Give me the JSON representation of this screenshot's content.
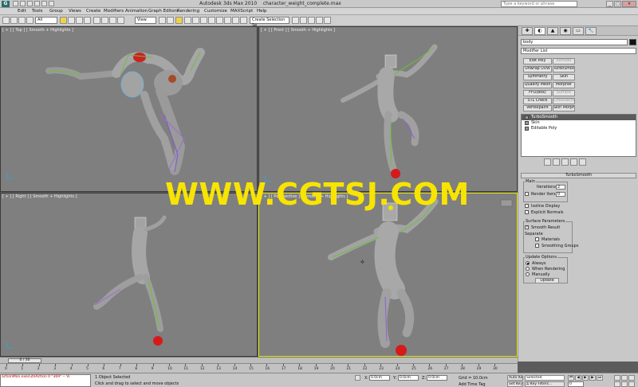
{
  "window": {
    "logo": "G",
    "title": "Autodesk 3ds Max  2010",
    "filename": "character_weight_complete.max",
    "search_placeholder": "Type a keyword or phrase",
    "win_min": "_",
    "win_max": "□",
    "win_close": "×"
  },
  "menu": [
    "Edit",
    "Tools",
    "Group",
    "Views",
    "Create",
    "Modifiers",
    "Animation",
    "Graph Editors",
    "Rendering",
    "Customize",
    "MAXScript",
    "Help"
  ],
  "toolbar": {
    "filter_value": "All",
    "refcoord_value": "View",
    "named_selection_placeholder": "Create Selection Se"
  },
  "viewports": {
    "top": "[ + ] [ Top ] [ Smooth + Highlights ]",
    "front": "[ + ] [ Front ] [ Smooth + Highlights ]",
    "right": "[ + ] [ Right ] [ Smooth + Highlights ]",
    "perspective": "[ + ] [ Perspective ] [ Smooth + Highlights ]"
  },
  "watermark": "WWW.CGTSJ.COM",
  "command_panel": {
    "tabs": [
      "✚",
      "◐",
      "▲",
      "◉",
      "▭",
      "🔧"
    ],
    "object_name": "body",
    "modifier_list": "Modifier List",
    "buttons": [
      [
        "Edit Poly",
        "Extrude"
      ],
      [
        "Unwrap UVW",
        "TurboSmooth"
      ],
      [
        "Symmetry",
        "Skin"
      ],
      [
        "Quadify Mesh",
        "Morpher"
      ],
      [
        "FFD(box)",
        "Surface"
      ],
      [
        "STL Check",
        "CrossSection"
      ],
      [
        "Vertexpaint",
        "Skin Morph"
      ]
    ],
    "stack": [
      "TurboSmooth",
      "Skin",
      "Editable Poly"
    ],
    "turbosmooth": {
      "header": "TurboSmooth",
      "main_group": "Main",
      "iterations_label": "Iterations:",
      "iterations_value": "2",
      "render_iters_label": "Render Iters:",
      "render_iters_value": "0",
      "isoline": "Isoline Display",
      "explicit": "Explicit Normals",
      "surface_group": "Surface Parameters",
      "smooth_result": "Smooth Result",
      "separate": "Separate",
      "materials": "Materials",
      "smoothing_groups": "Smoothing Groups",
      "update_group": "Update Options",
      "always": "Always",
      "when_rendering": "When Rendering",
      "manually": "Manually",
      "update_btn": "Update"
    }
  },
  "timeline": {
    "slider_label": "0 / 30",
    "ticks": [
      "0",
      "1",
      "2",
      "3",
      "4",
      "5",
      "6",
      "7",
      "8",
      "9",
      "10",
      "11",
      "12",
      "13",
      "14",
      "15",
      "16",
      "17",
      "18",
      "19",
      "20",
      "21",
      "22",
      "23",
      "24",
      "25",
      "26",
      "27",
      "28",
      "29",
      "30"
    ]
  },
  "status": {
    "script_line1": "actionMan.executeAction 0 \"369\"  -- Vi",
    "script_line2": "",
    "selection": "1 Object Selected",
    "prompt": "Click and drag to select and move objects",
    "x_label": "X:",
    "x_value": "0.0cm",
    "y_label": "Y:",
    "y_value": "0.0cm",
    "z_label": "Z:",
    "z_value": "0.0cm",
    "grid": "Grid = 10.0cm",
    "add_time_tag": "Add Time Tag",
    "auto_key": "Auto Key",
    "set_key": "Set Key",
    "key_mode": "Selected",
    "key_filters": "Key Filters...",
    "frame": "0"
  }
}
